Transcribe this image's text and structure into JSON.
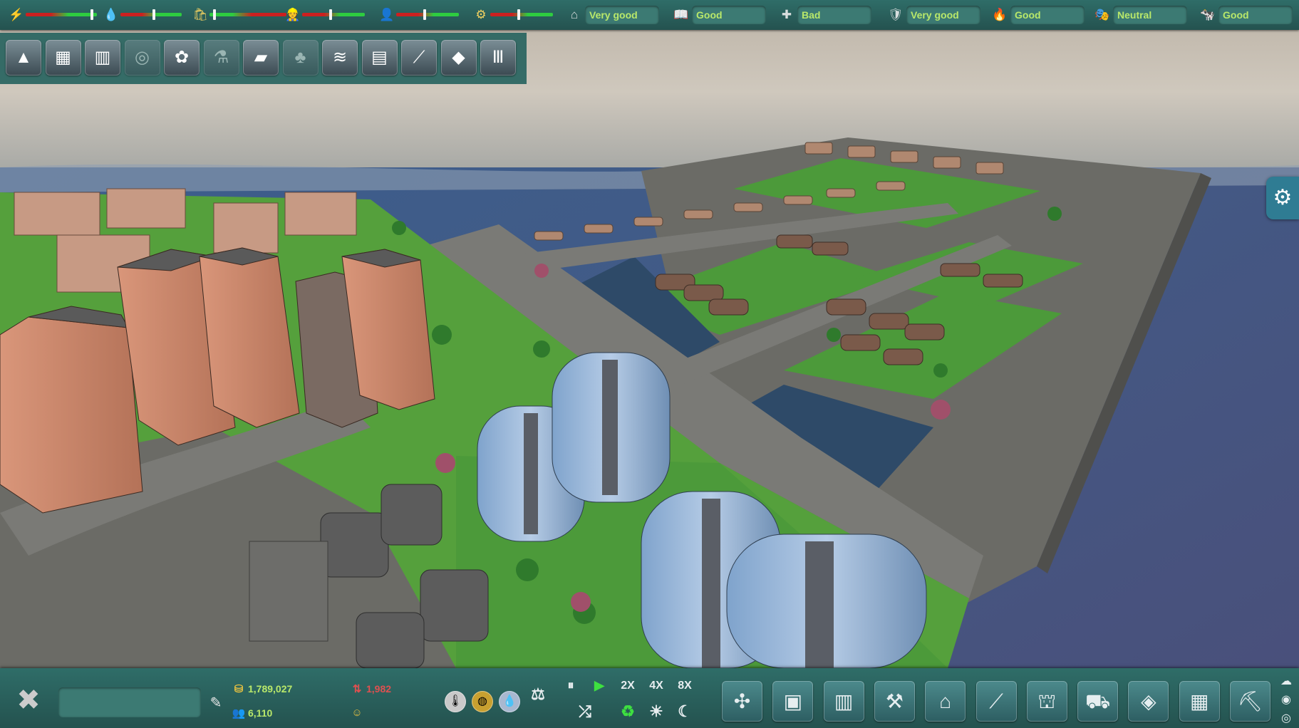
{
  "status_meters": [
    {
      "icon": "lightning-icon",
      "glyph": "⚡",
      "level": 0.95
    },
    {
      "icon": "water-drop-icon",
      "glyph": "💧",
      "level": 0.55
    },
    {
      "icon": "garbage-bag-icon",
      "glyph": "🛍",
      "level": 0.05
    },
    {
      "icon": "worker-icon",
      "glyph": "👷",
      "level": 0.45
    },
    {
      "icon": "office-worker-icon",
      "glyph": "👤",
      "level": 0.45
    },
    {
      "icon": "machine-icon",
      "glyph": "⚙",
      "level": 0.45
    }
  ],
  "opinions": [
    {
      "icon": "house-icon",
      "glyph": "⌂",
      "label": "Very good"
    },
    {
      "icon": "book-icon",
      "glyph": "📖",
      "label": "Good"
    },
    {
      "icon": "health-cross-icon",
      "glyph": "✚",
      "label": "Bad"
    },
    {
      "icon": "police-icon",
      "glyph": "🛡",
      "label": "Very good"
    },
    {
      "icon": "fire-icon",
      "glyph": "🔥",
      "label": "Good"
    },
    {
      "icon": "theatre-icon",
      "glyph": "🎭",
      "label": "Neutral"
    },
    {
      "icon": "cow-icon",
      "glyph": "🐄",
      "label": "Good"
    }
  ],
  "category_buttons": [
    {
      "name": "category-terrain-icon",
      "glyph": "▲",
      "dim": false
    },
    {
      "name": "category-boxes-icon",
      "glyph": "▦",
      "dim": false
    },
    {
      "name": "category-city-icon",
      "glyph": "▥",
      "dim": false
    },
    {
      "name": "category-monument-icon",
      "glyph": "◎",
      "dim": true
    },
    {
      "name": "category-flowers-icon",
      "glyph": "✿",
      "dim": false
    },
    {
      "name": "category-lab-flask-icon",
      "glyph": "⚗",
      "dim": true
    },
    {
      "name": "category-solar-icon",
      "glyph": "▰",
      "dim": false
    },
    {
      "name": "category-tree-icon",
      "glyph": "♣",
      "dim": true
    },
    {
      "name": "category-field-icon",
      "glyph": "≋",
      "dim": false
    },
    {
      "name": "category-document-icon",
      "glyph": "▤",
      "dim": false
    },
    {
      "name": "category-highway-icon",
      "glyph": "⟋",
      "dim": false
    },
    {
      "name": "category-pyramid-icon",
      "glyph": "◆",
      "dim": false
    },
    {
      "name": "category-pillars-icon",
      "glyph": "Ⅲ",
      "dim": false
    }
  ],
  "settings_glyph": "⚙",
  "bottom": {
    "city_name": "",
    "tools_glyph": "✖",
    "rename_glyph": "✎",
    "money_glyph": "⛁",
    "money": "1,789,027",
    "population_glyph": "👥",
    "population": "6,110",
    "income_glyph": "⇅",
    "income": "1,982",
    "happiness_glyph": "☺",
    "resources": [
      {
        "name": "thermometer-icon",
        "glyph": "🌡",
        "color": "#c9c9c9"
      },
      {
        "name": "gold-coin-icon",
        "glyph": "◍",
        "color": "#c8a030"
      },
      {
        "name": "water-drop-button-icon",
        "glyph": "💧",
        "color": "#a8b8d0"
      }
    ],
    "balance_glyph": "⚖",
    "pause_label": "⏸",
    "play_label": "▶",
    "speeds": [
      "2X",
      "4X",
      "8X"
    ],
    "shuffle_label": "⤮",
    "eco_label": "♻",
    "sun_label": "☀",
    "moon_label": "☾",
    "build_buttons": [
      {
        "name": "build-wind-turbine-icon",
        "glyph": "✣"
      },
      {
        "name": "build-residential-icon",
        "glyph": "▣"
      },
      {
        "name": "build-commercial-icon",
        "glyph": "▥"
      },
      {
        "name": "build-industry-icon",
        "glyph": "⚒"
      },
      {
        "name": "build-factory-icon",
        "glyph": "⌂"
      },
      {
        "name": "build-road-icon",
        "glyph": "⟋"
      },
      {
        "name": "build-services-icon",
        "glyph": "⛫"
      },
      {
        "name": "build-transport-icon",
        "glyph": "⛟"
      },
      {
        "name": "build-structure-icon",
        "glyph": "◈"
      },
      {
        "name": "build-storage-icon",
        "glyph": "▦"
      },
      {
        "name": "build-demolish-icon",
        "glyph": "⛏"
      }
    ],
    "side_icons": [
      {
        "name": "weather-icon",
        "glyph": "☁"
      },
      {
        "name": "camera-icon",
        "glyph": "◉"
      },
      {
        "name": "eye-icon",
        "glyph": "◎"
      }
    ]
  },
  "colors": {
    "bar_bg": "#2a5c58",
    "opinion_text": "#b9e86a",
    "meter_red": "#cc2020",
    "meter_green": "#2ecc40"
  }
}
